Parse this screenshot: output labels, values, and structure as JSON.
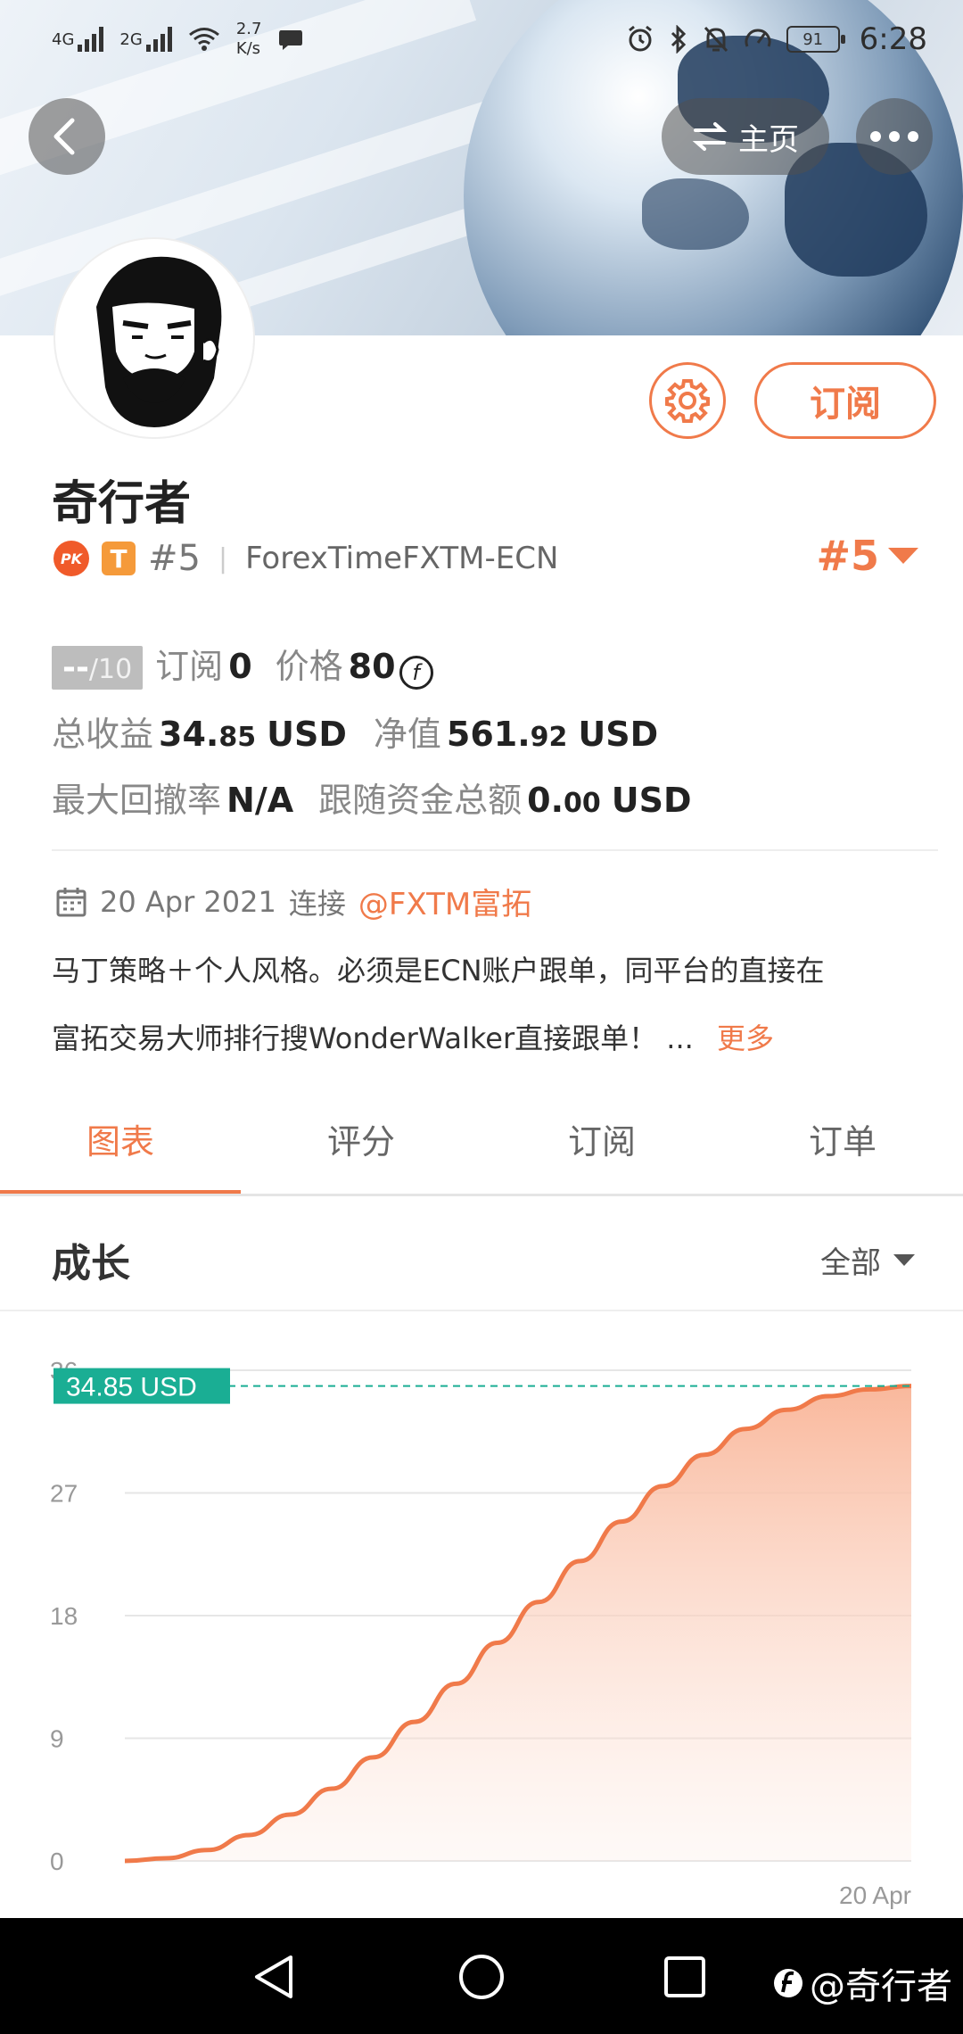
{
  "status_bar": {
    "net1": "4G",
    "net2": "2G",
    "speed": "2.7\nK/s",
    "battery": "91",
    "time": "6:28"
  },
  "header": {
    "home_label": "主页",
    "subscribe_label": "订阅"
  },
  "profile": {
    "name": "奇行者",
    "pk_badge": "PK",
    "t_badge": "T",
    "rank": "#5",
    "broker": "ForexTimeFXTM-ECN",
    "rank_right": "#5"
  },
  "stats": {
    "score_value": "--",
    "score_max": "/10",
    "subscribe_label": "订阅",
    "subscribe_count": "0",
    "price_label": "价格",
    "price_value": "80",
    "coin_symbol": "f",
    "total_profit_label": "总收益",
    "total_profit_int": "34.",
    "total_profit_dec": "85",
    "total_profit_unit": "USD",
    "equity_label": "净值",
    "equity_int": "561.",
    "equity_dec": "92",
    "equity_unit": "USD",
    "max_drawdown_label": "最大回撤率",
    "max_drawdown_value": "N/A",
    "follow_funds_label": "跟随资金总额",
    "follow_funds_int": "0.",
    "follow_funds_dec": "00",
    "follow_funds_unit": "USD"
  },
  "connection": {
    "date": "20 Apr 2021",
    "connect_label": "连接",
    "account": "@FXTM富拓"
  },
  "description": {
    "line1": "马丁策略＋个人风格。必须是ECN账户跟单，同平台的直接在",
    "line2": "富拓交易大师排行搜WonderWalker直接跟单！ ...",
    "more_label": "更多"
  },
  "tabs": [
    "图表",
    "评分",
    "订阅",
    "订单"
  ],
  "growth": {
    "title": "成长",
    "filter_label": "全部"
  },
  "chart_data": {
    "type": "area",
    "y_ticks": [
      "36",
      "27",
      "18",
      "9",
      "0"
    ],
    "ylim": [
      0,
      36
    ],
    "x_tick_label": "20 Apr",
    "current_label": "34.85 USD",
    "current_value": 34.85,
    "values": [
      0,
      0.2,
      0.8,
      1.9,
      3.4,
      5.3,
      7.6,
      10.2,
      13.0,
      16.0,
      19.0,
      22.0,
      24.9,
      27.5,
      29.8,
      31.7,
      33.1,
      34.1,
      34.6,
      34.85
    ]
  },
  "watermark": "@奇行者",
  "colors": {
    "accent": "#f07a4a",
    "chart_fill_top": "#f9b89c",
    "label_bg": "#1aae94"
  }
}
